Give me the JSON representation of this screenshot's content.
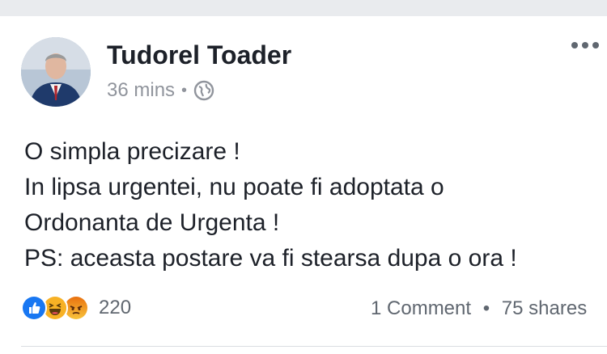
{
  "post": {
    "author": "Tudorel Toader",
    "time": "36 mins",
    "meta_separator": "•",
    "privacy_icon": "globe-icon",
    "lines": [
      "O simpla precizare !",
      "In lipsa urgentei, nu poate fi adoptata o",
      "Ordonanta de Urgenta !",
      "PS: aceasta postare va fi stearsa dupa o ora !"
    ]
  },
  "reactions": {
    "icons": [
      "like-reaction-icon",
      "haha-reaction-icon",
      "angry-reaction-icon"
    ],
    "count": "220"
  },
  "social": {
    "comments": "1 Comment",
    "separator": "•",
    "shares": "75 shares"
  },
  "colors": {
    "like": "#1877f2",
    "haha": "#f7b125",
    "angry": "#e9710f",
    "text": "#1d2129",
    "muted": "#90949c"
  }
}
